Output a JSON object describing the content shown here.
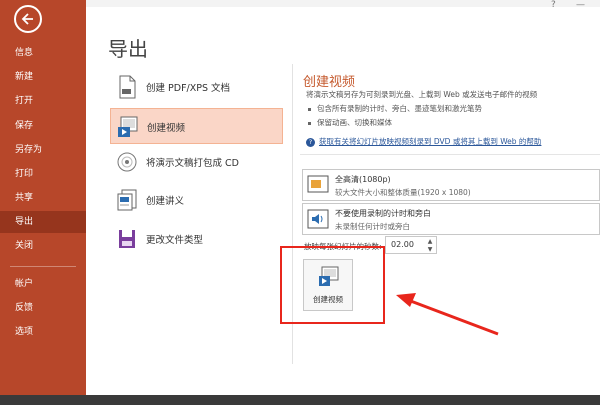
{
  "sidebar": {
    "items": [
      {
        "label": "信息"
      },
      {
        "label": "新建"
      },
      {
        "label": "打开"
      },
      {
        "label": "保存"
      },
      {
        "label": "另存为"
      },
      {
        "label": "打印"
      },
      {
        "label": "共享"
      },
      {
        "label": "导出",
        "active": true
      },
      {
        "label": "关闭"
      },
      {
        "label": "帐户"
      },
      {
        "label": "反馈"
      },
      {
        "label": "选项"
      }
    ]
  },
  "main": {
    "title": "导出",
    "export_options": [
      {
        "label": "创建 PDF/XPS 文档",
        "icon": "pdf-document-icon"
      },
      {
        "label": "创建视频",
        "icon": "create-video-icon",
        "selected": true
      },
      {
        "label": "将演示文稿打包成 CD",
        "icon": "cd-disc-icon"
      },
      {
        "label": "创建讲义",
        "icon": "handout-icon"
      },
      {
        "label": "更改文件类型",
        "icon": "change-file-type-icon"
      }
    ]
  },
  "panel": {
    "title": "创建视频",
    "description": "将演示文稿另存为可刻录到光盘、上载到 Web 或发送电子邮件的视频",
    "bullets": [
      "包含所有录制的计时、旁白、墨迹笔划和激光笔势",
      "保留动画、切换和媒体"
    ],
    "help_link": "获取有关将幻灯片放映视频刻录到 DVD 或将其上载到 Web 的帮助",
    "quality_dropdown": {
      "title": "全高清(1080p)",
      "subtitle": "较大文件大小和整体质量(1920 x 1080)"
    },
    "timing_dropdown": {
      "title": "不要使用录制的计时和旁白",
      "subtitle": "未录制任何计时或旁白"
    },
    "seconds_label": "放映每张幻灯片的秒数:",
    "seconds_value": "02.00",
    "create_button_label": "创建视频"
  },
  "colors": {
    "sidebar": "#b7472a",
    "sidebar_active": "#96351d",
    "accent_text": "#c55a2e",
    "selected_bg": "#fad6c7",
    "highlight_red": "#e8261c",
    "link": "#2b579a"
  }
}
